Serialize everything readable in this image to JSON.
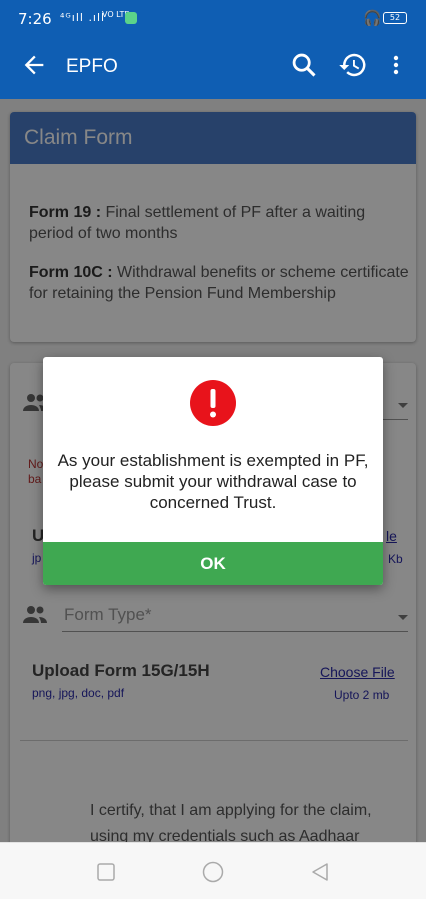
{
  "status_bar": {
    "time": "7:26",
    "signal": "⁴ᴳıll .ıll",
    "network": "VO LTE",
    "battery": "52"
  },
  "app_bar": {
    "title": "EPFO"
  },
  "claim_card": {
    "header": "Claim Form",
    "form19_label": "Form 19 :",
    "form19_text": " Final settlement of PF after a waiting period of two months",
    "form10c_label": "Form 10C :",
    "form10c_text": " Withdrawal benefits or scheme certificate for retaining the Pension Fund Membership"
  },
  "form_card": {
    "partial_note": "No\nba",
    "partial_upload": "U",
    "partial_types": "jp",
    "partial_choose": "le",
    "partial_kb": "Kb",
    "form_type_placeholder": "Form Type*",
    "upload_title": "Upload Form 15G/15H",
    "upload_types": "png, jpg, doc, pdf",
    "choose_file": "Choose File",
    "upload_limit": "Upto 2 mb",
    "certify_text": "I certify, that I am applying for the claim, using my credentials such as Aadhaar"
  },
  "dialog": {
    "icon": "error-icon",
    "message": "As your establishment is exempted in PF, please submit your withdrawal case to concerned Trust.",
    "ok_label": "OK",
    "accent_color": "#3fa851",
    "icon_color": "#e8131b"
  }
}
